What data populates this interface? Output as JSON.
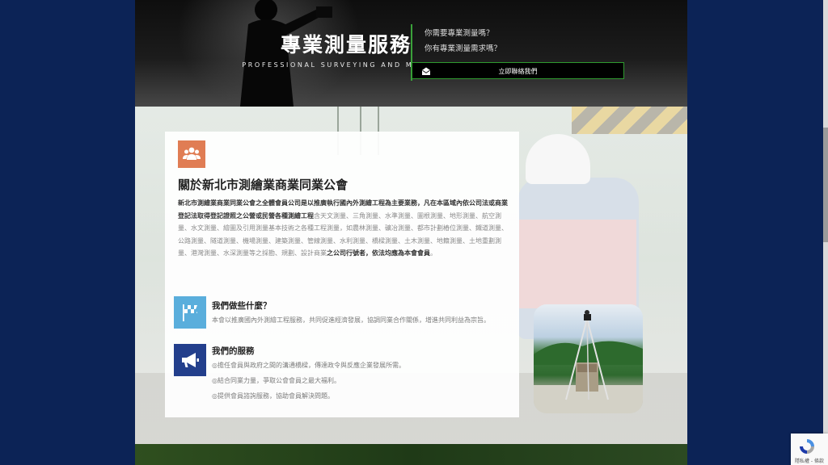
{
  "hero": {
    "title": "專業測量服務",
    "subtitle": "PROFESSIONAL SURVEYING AND MAPPING",
    "question1": "你需要專業測量嗎？",
    "question2": "你有專業測量需求嗎？",
    "contact_button": "立即聯絡我們"
  },
  "about": {
    "title": "關於新北市測繪業商業同業公會",
    "body_intro_bold": "新北市測繪業商業同業公會之全體會員公司是以推廣執行國內外測繪工程為主要業務，凡在本區域內依公司法或商業登記法取得登記證照之公營或民營各種測繪工程",
    "body_middle": "含天文測量、三角測量、水準測量、圖根測量、地形測量、航空測量、水文測量、繪圖及引用測量基本技術之各種工程測量，如農林測量、礦冶測量、都市計劃樁位測量、鐵道測量、公路測量、隧道測量、機場測量、建築測量、管線測量、水利測量、橋樑測量、土木測量、地籍測量、土地重劃測量、港灣測量、水深測量等之採勘、規劃、設計商業",
    "body_end_bold": "之公司行號者，依法均應為本會會員",
    "body_period": "。"
  },
  "features": [
    {
      "title": "我們做些什麼？",
      "lines": [
        "本會以推廣國內外測繪工程服務，共同促進經濟發展，協調同業合作關係，增進共同利益為宗旨。"
      ]
    },
    {
      "title": "我們的服務",
      "lines": [
        "◎擔任會員與政府之間的溝通橋樑，傳達政令與反應企業發展所需。",
        "◎結合同業力量，爭取公會會員之最大福利。",
        "◎提供會員諮詢服務，協助會員解決問題。"
      ]
    }
  ],
  "recaptcha": {
    "text": "隱私權 - 條款"
  },
  "colors": {
    "accent_green": "#3aa13a",
    "about_icon": "#e07d54",
    "feature_blue": "#5aaedc",
    "feature_navy": "#233f8c",
    "page_background": "#0c2356"
  },
  "icons": {
    "about": "users-group-icon",
    "what_we_do": "checkered-flag-icon",
    "services": "megaphone-icon",
    "contact": "envelope-open-icon"
  }
}
